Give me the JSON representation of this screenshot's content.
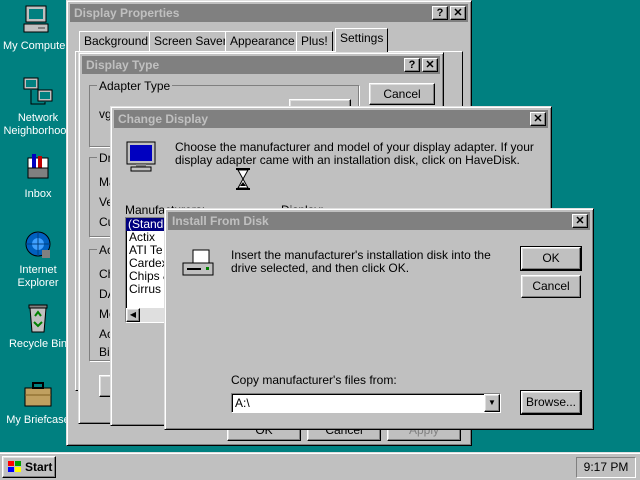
{
  "desktop": {
    "icons": [
      {
        "label": "My Computer"
      },
      {
        "label": "Network"
      },
      {
        "label": "Neighborhood"
      },
      {
        "label": "Inbox"
      },
      {
        "label": "Internet"
      },
      {
        "label": "Explorer"
      },
      {
        "label": "Recycle Bin"
      },
      {
        "label": "My Briefcase"
      }
    ]
  },
  "display_properties": {
    "title": "Display Properties",
    "help": "?",
    "close": "✕",
    "tabs": [
      "Background",
      "Screen Saver",
      "Appearance",
      "Plus!",
      "Settings"
    ],
    "bottom_buttons": [
      "OK",
      "Cancel",
      "Apply"
    ],
    "left_label_fragment": "L"
  },
  "display_type": {
    "title": "Display Type",
    "help": "?",
    "close": "✕",
    "adapter_group": "Adapter Type",
    "adapter_value_fragment": "vg",
    "cancel": "Cancel",
    "driver_group_fragment": "Dr",
    "rows_fragments": [
      "Ma",
      "Ve",
      "Cu"
    ],
    "adv_group_fragment": "Ac",
    "adv_rows_fragments": [
      "Ch",
      "DA",
      "Me",
      "Ac",
      "Bic"
    ]
  },
  "change_display": {
    "title": "Change Display",
    "close": "✕",
    "message": "Choose the manufacturer and model of your display adapter.  If your display adapter came with an installation disk, click on HaveDisk.",
    "manufacturers_label": "Manufacturers:",
    "display_label": "Display:",
    "manufacturers": [
      "(Standa",
      "Actix",
      "ATI Te",
      "Cardex",
      "Chips &",
      "Cirrus L"
    ]
  },
  "install_from_disk": {
    "title": "Install From Disk",
    "close": "✕",
    "message": "Insert the manufacturer's installation disk into the drive selected, and then click OK.",
    "ok": "OK",
    "cancel": "Cancel",
    "copy_label": "Copy manufacturer's files from:",
    "path_value": "A:\\",
    "browse": "Browse..."
  },
  "taskbar": {
    "start": "Start",
    "clock": "9:17 PM"
  },
  "colors": {
    "desktop": "#008080",
    "title_active": "#000080",
    "title_inactive": "#808080",
    "face": "#c0c0c0"
  }
}
